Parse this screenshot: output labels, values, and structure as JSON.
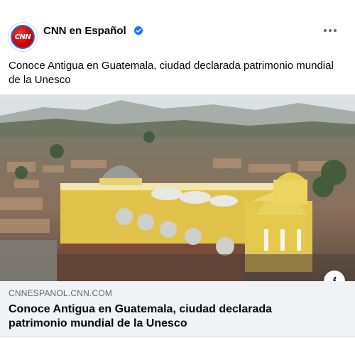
{
  "post": {
    "page_name": "CNN en Español",
    "avatar_text": "CNN",
    "verified": true,
    "message": "Conoce Antigua en Guatemala, ciudad declarada patrimonio mundial de la Unesco"
  },
  "link_preview": {
    "domain": "CNNESPANOL.CNN.COM",
    "title": "Conoce Antigua en Guatemala, ciudad declarada patrimonio mundial de la Unesco",
    "info_label": "i"
  },
  "icons": {
    "verified": "verified-badge-icon",
    "more": "more-options-icon",
    "info": "info-icon"
  },
  "colors": {
    "brand_red": "#cc0000",
    "verified_blue": "#1877f2",
    "link_box_bg": "#f0f2f5",
    "muted_text": "#65676b"
  }
}
